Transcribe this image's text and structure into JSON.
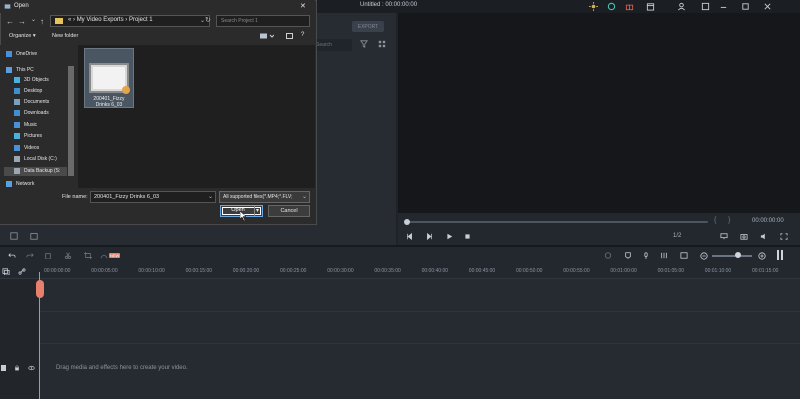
{
  "editor": {
    "project_title": "Untitled : 00:00:00:00",
    "export_label": "EXPORT",
    "media_search_placeholder": "Search",
    "player": {
      "time": "00:00:00:00",
      "zoom": "1/2",
      "bracket_in": "{",
      "bracket_out": "}"
    },
    "timeline": {
      "ruler_ticks": [
        "00:00:00:00",
        "00:00:05:00",
        "00:00:10:00",
        "00:00:15:00",
        "00:00:20:00",
        "00:00:25:00",
        "00:00:30:00",
        "00:00:35:00",
        "00:00:40:00",
        "00:00:45:00",
        "00:00:50:00",
        "00:00:55:00",
        "00:01:00:00",
        "00:01:05:00",
        "00:01:10:00",
        "00:01:15:00"
      ],
      "drop_hint": "Drag media and effects here to create your video.",
      "new_badge": "NEW"
    }
  },
  "dialog": {
    "title": "Open",
    "close_glyph": "✕",
    "breadcrumb": [
      "My Video Exports",
      "Project 1"
    ],
    "breadcrumb_prefix": "«",
    "breadcrumb_sep": "›",
    "search_placeholder": "Search Project 1",
    "organize_label": "Organize ▾",
    "new_folder_label": "New folder",
    "help_glyph": "?",
    "tree": [
      {
        "label": "OneDrive",
        "color": "#4a90d9"
      },
      {
        "label": "This PC",
        "color": "#5aa0e0"
      },
      {
        "label": "3D Objects",
        "color": "#4ab0e0"
      },
      {
        "label": "Desktop",
        "color": "#3f8fd0"
      },
      {
        "label": "Documents",
        "color": "#7aa0c0"
      },
      {
        "label": "Downloads",
        "color": "#3f8fd0"
      },
      {
        "label": "Music",
        "color": "#4a90d9"
      },
      {
        "label": "Pictures",
        "color": "#4ab0e0"
      },
      {
        "label": "Videos",
        "color": "#4a90d9"
      },
      {
        "label": "Local Disk (C:)",
        "color": "#9aa7b3"
      },
      {
        "label": "Data Backup (S:",
        "color": "#9aa7b3"
      },
      {
        "label": "Network",
        "color": "#5aa0e0"
      }
    ],
    "file": {
      "name": "200401_Fizzy Drinks 6_03"
    },
    "filename_label": "File name:",
    "filename_value": "200401_Fizzy Drinks 6_03",
    "filetype_value": "All supported files(*.MP4;*.FLV;",
    "open_label": "Open",
    "cancel_label": "Cancel"
  }
}
